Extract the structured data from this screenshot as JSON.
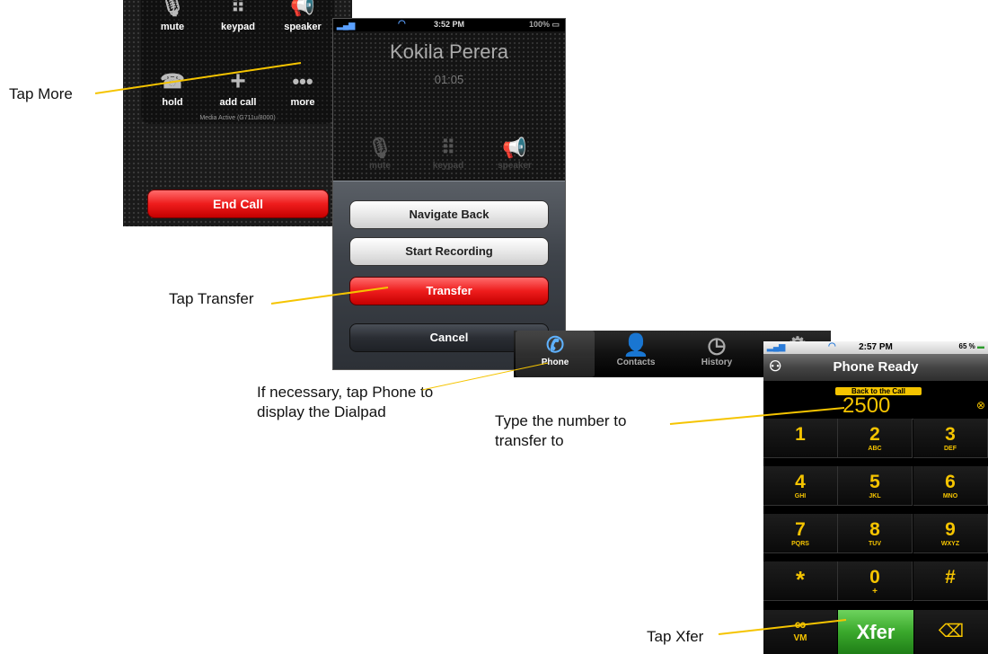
{
  "colors": {
    "callout_line": "#f5c400",
    "accent_yellow": "#f5c400",
    "end_red": "#ee1c1c",
    "xfer_green": "#3aa82c"
  },
  "callouts": {
    "tap_more": "Tap More",
    "tap_transfer": "Tap Transfer",
    "tap_phone_line1": "If necessary, tap Phone to",
    "tap_phone_line2": "display the Dialpad",
    "type_number_line1": "Type the number to",
    "type_number_line2": "transfer to",
    "tap_xfer": "Tap Xfer"
  },
  "screen1": {
    "buttons": [
      {
        "label": "mute",
        "icon": "mute-mic-icon"
      },
      {
        "label": "keypad",
        "icon": "keypad-icon"
      },
      {
        "label": "speaker",
        "icon": "speaker-icon"
      },
      {
        "label": "hold",
        "icon": "hold-icon"
      },
      {
        "label": "add call",
        "icon": "add-call-icon"
      },
      {
        "label": "more",
        "icon": "more-dots-icon"
      }
    ],
    "media_status": "Media Active (G711u/8000)",
    "end_call": "End Call"
  },
  "screen2": {
    "status_time": "3:52 PM",
    "status_battery": "100%",
    "caller_name": "Kokila Perera",
    "call_timer": "01:05",
    "dim_labels": [
      "mute",
      "keypad",
      "speaker"
    ],
    "sheet": {
      "navigate_back": "Navigate Back",
      "start_recording": "Start Recording",
      "transfer": "Transfer",
      "cancel": "Cancel"
    }
  },
  "tabbar": {
    "tabs": [
      {
        "label": "Phone",
        "icon": "phone-handset-icon",
        "active": true
      },
      {
        "label": "Contacts",
        "icon": "contacts-person-icon",
        "active": false
      },
      {
        "label": "History",
        "icon": "history-clock-icon",
        "active": false
      },
      {
        "label": "",
        "icon": "settings-gear-icon",
        "active": false
      }
    ]
  },
  "screen4": {
    "status_time": "2:57 PM",
    "status_battery": "65 %",
    "title": "Phone Ready",
    "back_to_call": "Back to the Call",
    "number": "2500",
    "keys": [
      {
        "digit": "1",
        "letters": ""
      },
      {
        "digit": "2",
        "letters": "ABC"
      },
      {
        "digit": "3",
        "letters": "DEF"
      },
      {
        "digit": "4",
        "letters": "GHI"
      },
      {
        "digit": "5",
        "letters": "JKL"
      },
      {
        "digit": "6",
        "letters": "MNO"
      },
      {
        "digit": "7",
        "letters": "PQRS"
      },
      {
        "digit": "8",
        "letters": "TUV"
      },
      {
        "digit": "9",
        "letters": "WXYZ"
      },
      {
        "digit": "*",
        "letters": ""
      },
      {
        "digit": "0",
        "letters": "+"
      },
      {
        "digit": "#",
        "letters": ""
      }
    ],
    "voicemail_label": "VM",
    "xfer": "Xfer"
  }
}
